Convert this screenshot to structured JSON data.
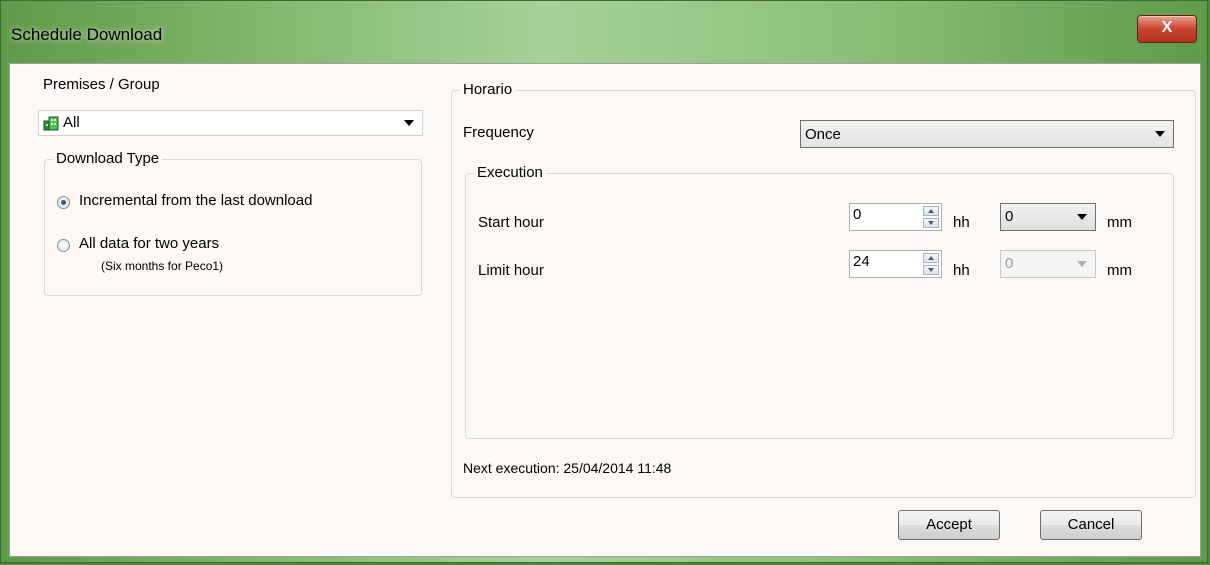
{
  "window": {
    "title": "Schedule Download",
    "close_label": "X"
  },
  "left": {
    "premises_label": "Premises / Group",
    "premises_value": "All",
    "download_type": {
      "title": "Download Type",
      "options": [
        {
          "label": "Incremental from the last download",
          "checked": true
        },
        {
          "label": "All data for two years",
          "note": "(Six months for Peco1)",
          "checked": false
        }
      ]
    }
  },
  "horario": {
    "title": "Horario",
    "frequency_label": "Frequency",
    "frequency_value": "Once",
    "execution": {
      "title": "Execution",
      "start": {
        "label": "Start hour",
        "hour": "0",
        "hh": "hh",
        "minute": "0",
        "mm": "mm"
      },
      "limit": {
        "label": "Limit hour",
        "hour": "24",
        "hh": "hh",
        "minute": "0",
        "mm": "mm"
      }
    },
    "next_execution": "Next execution: 25/04/2014 11:48"
  },
  "buttons": {
    "accept": "Accept",
    "cancel": "Cancel"
  }
}
